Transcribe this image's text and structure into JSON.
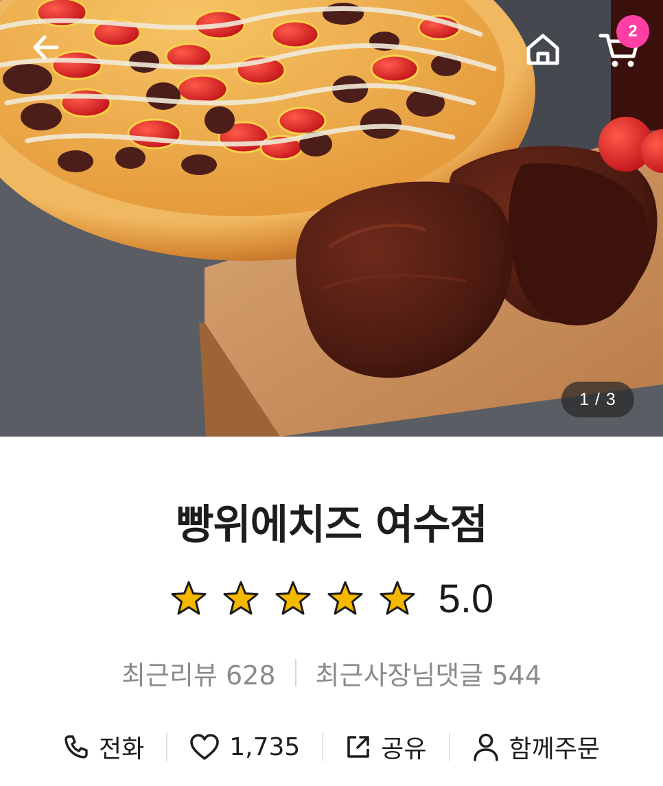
{
  "header": {
    "back_icon": "arrow-left-icon",
    "home_icon": "home-icon",
    "cart_icon": "cart-icon",
    "cart_count": "2"
  },
  "gallery": {
    "pager": "1 / 3",
    "current": 1,
    "total": 3,
    "image": "pizza-and-steak-photo"
  },
  "store": {
    "name": "빵위에치즈 여수점",
    "rating": "5.0",
    "stars_filled": 5,
    "stars_total": 5,
    "recent_reviews_label": "최근리뷰 628",
    "owner_replies_label": "최근사장님댓글 544"
  },
  "actions": {
    "call_label": "전화",
    "like_count": "1,735",
    "share_label": "공유",
    "group_order_label": "함께주문"
  },
  "colors": {
    "badge": "#ff3fa4",
    "star": "#f5b800",
    "muted_text": "#8b8b8b"
  }
}
